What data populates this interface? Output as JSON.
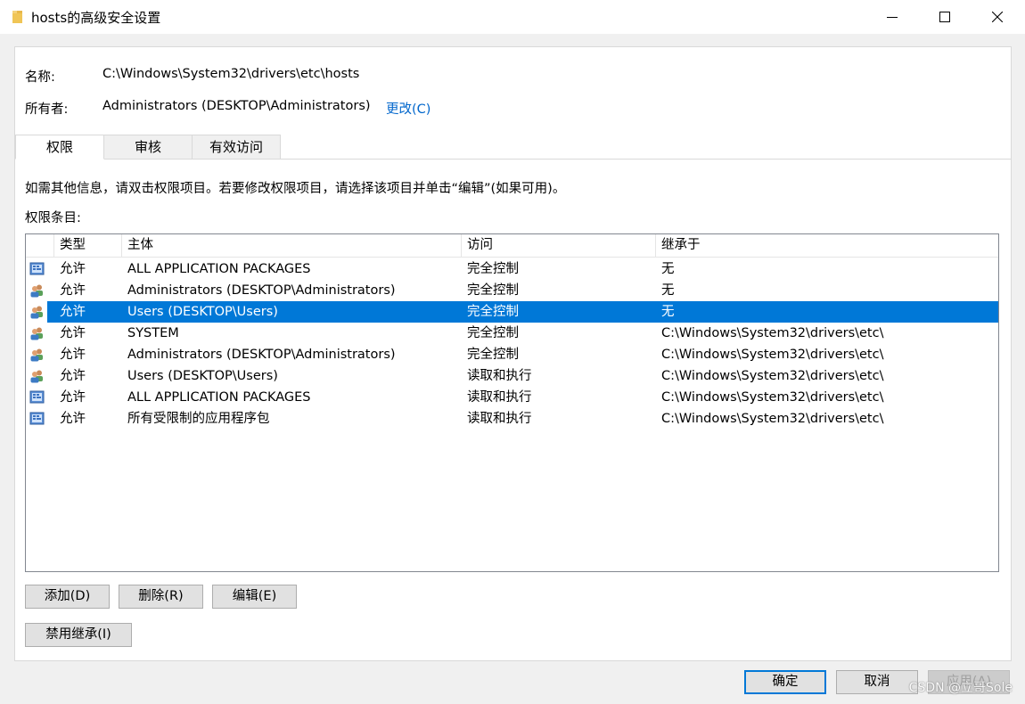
{
  "window": {
    "title": "hosts的高级安全设置",
    "icon": "folder-icon"
  },
  "info": {
    "name_label": "名称:",
    "name_value": "C:\\Windows\\System32\\drivers\\etc\\hosts",
    "owner_label": "所有者:",
    "owner_value": "Administrators (DESKTOP\\Administrators)",
    "change_link": "更改(C)"
  },
  "tabs": [
    {
      "label": "权限",
      "active": true
    },
    {
      "label": "审核",
      "active": false
    },
    {
      "label": "有效访问",
      "active": false
    }
  ],
  "instructions": "如需其他信息，请双击权限项目。若要修改权限项目，请选择该项目并单击“编辑”(如果可用)。",
  "entries_label": "权限条目:",
  "list": {
    "columns": [
      "类型",
      "主体",
      "访问",
      "继承于"
    ],
    "rows": [
      {
        "icon": "app-package-icon",
        "type": "允许",
        "principal": "ALL APPLICATION PACKAGES",
        "access": "完全控制",
        "inherited": "无",
        "selected": false
      },
      {
        "icon": "users-group-icon",
        "type": "允许",
        "principal": "Administrators (DESKTOP\\Administrators)",
        "access": "完全控制",
        "inherited": "无",
        "selected": false
      },
      {
        "icon": "users-group-icon",
        "type": "允许",
        "principal": "Users (DESKTOP\\Users)",
        "access": "完全控制",
        "inherited": "无",
        "selected": true
      },
      {
        "icon": "users-group-icon",
        "type": "允许",
        "principal": "SYSTEM",
        "access": "完全控制",
        "inherited": "C:\\Windows\\System32\\drivers\\etc\\",
        "selected": false
      },
      {
        "icon": "users-group-icon",
        "type": "允许",
        "principal": "Administrators (DESKTOP\\Administrators)",
        "access": "完全控制",
        "inherited": "C:\\Windows\\System32\\drivers\\etc\\",
        "selected": false
      },
      {
        "icon": "users-group-icon",
        "type": "允许",
        "principal": "Users (DESKTOP\\Users)",
        "access": "读取和执行",
        "inherited": "C:\\Windows\\System32\\drivers\\etc\\",
        "selected": false
      },
      {
        "icon": "app-package-icon",
        "type": "允许",
        "principal": "ALL APPLICATION PACKAGES",
        "access": "读取和执行",
        "inherited": "C:\\Windows\\System32\\drivers\\etc\\",
        "selected": false
      },
      {
        "icon": "app-package-icon",
        "type": "允许",
        "principal": "所有受限制的应用程序包",
        "access": "读取和执行",
        "inherited": "C:\\Windows\\System32\\drivers\\etc\\",
        "selected": false
      }
    ]
  },
  "buttons": {
    "add": "添加(D)",
    "remove": "删除(R)",
    "edit": "编辑(E)",
    "disable_inheritance": "禁用继承(I)",
    "ok": "确定",
    "cancel": "取消",
    "apply": "应用(A)"
  },
  "watermark": "CSDN @立哥Sole",
  "colors": {
    "selection": "#0078d7",
    "link": "#0066cc",
    "dialog_bg": "#f0f0f0"
  }
}
